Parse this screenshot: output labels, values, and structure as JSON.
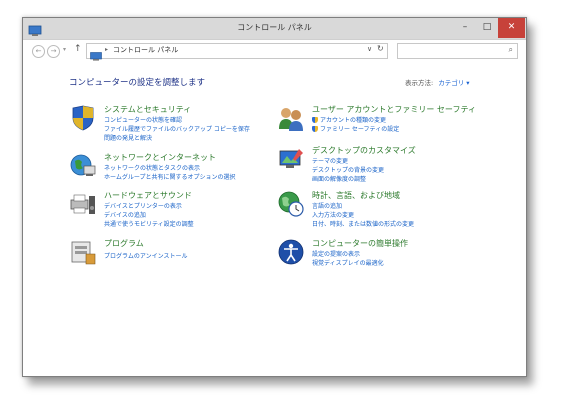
{
  "window": {
    "title": "コントロール パネル",
    "min_glyph": "–",
    "max_glyph": "□",
    "close_glyph": "✕"
  },
  "nav": {
    "back_glyph": "←",
    "forward_glyph": "→",
    "history_glyph": "▾",
    "up_glyph": "↑"
  },
  "address": {
    "separator": "▸",
    "path": "コントロール パネル",
    "dropdown_glyph": "∨",
    "refresh_glyph": "↻"
  },
  "search": {
    "placeholder": "",
    "icon_glyph": "⌕"
  },
  "main": {
    "heading": "コンピューターの設定を調整します",
    "view_by_label": "表示方法:",
    "view_by_value": "カテゴリ ▾"
  },
  "categories": [
    {
      "title": "システムとセキュリティ",
      "icon": "shield-flag-icon",
      "links": [
        "コンピューターの状態を確認",
        "ファイル履歴でファイルのバックアップ コピーを保存",
        "問題の発見と解決"
      ]
    },
    {
      "title": "ネットワークとインターネット",
      "icon": "network-globe-icon",
      "links": [
        "ネットワークの状態とタスクの表示",
        "ホームグループと共有に関するオプションの選択"
      ]
    },
    {
      "title": "ハードウェアとサウンド",
      "icon": "printer-speaker-icon",
      "links": [
        "デバイスとプリンターの表示",
        "デバイスの追加",
        "共通で使うモビリティ設定の調整"
      ]
    },
    {
      "title": "プログラム",
      "icon": "programs-box-icon",
      "links": [
        "プログラムのアンインストール"
      ]
    },
    {
      "title": "ユーザー アカウントとファミリー セーフティ",
      "icon": "users-icon",
      "links": [
        "アカウントの種類の変更",
        "ファミリー セーフティの設定"
      ]
    },
    {
      "title": "デスクトップのカスタマイズ",
      "icon": "monitor-brush-icon",
      "links": [
        "テーマの変更",
        "デスクトップの背景の変更",
        "画面の解像度の調整"
      ]
    },
    {
      "title": "時計、言語、および地域",
      "icon": "clock-globe-icon",
      "links": [
        "言語の追加",
        "入力方法の変更",
        "日付、時刻、または数値の形式の変更"
      ]
    },
    {
      "title": "コンピューターの簡単操作",
      "icon": "ease-of-access-icon",
      "links": [
        "設定の提案の表示",
        "視覚ディスプレイの最適化"
      ]
    }
  ]
}
